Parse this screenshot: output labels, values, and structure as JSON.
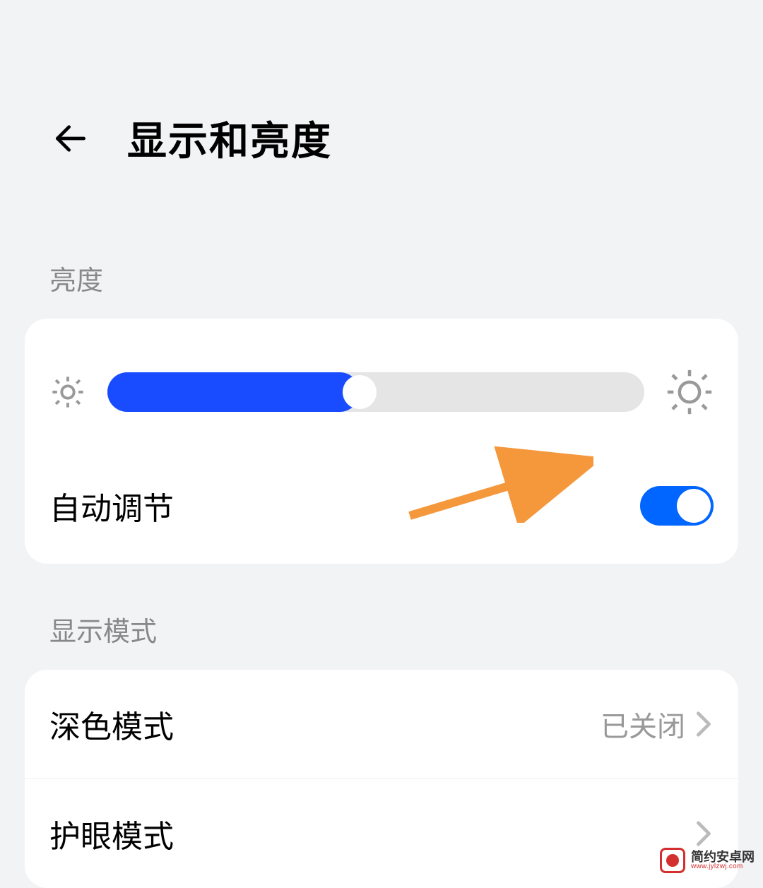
{
  "header": {
    "title": "显示和亮度"
  },
  "sections": {
    "brightness": {
      "label": "亮度",
      "slider_percent": 47,
      "auto_adjust": {
        "label": "自动调节",
        "enabled": true
      }
    },
    "display_mode": {
      "label": "显示模式",
      "items": [
        {
          "label": "深色模式",
          "value": "已关闭"
        },
        {
          "label": "护眼模式",
          "value": ""
        }
      ]
    }
  },
  "watermark": {
    "name": "简约安卓网",
    "url": "www.jylzwj.com"
  }
}
